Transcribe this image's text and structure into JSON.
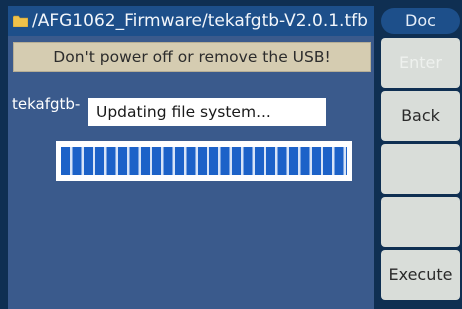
{
  "titlebar": {
    "path": "/AFG1062_Firmware/tekafgtb-V2.0.1.tfb",
    "folder_icon": "folder-icon",
    "folder_color": "#f0c24a"
  },
  "warning": {
    "text": "Don't power off or remove the USB!"
  },
  "file_line": {
    "text": "tekafgtb-"
  },
  "dialog": {
    "message": "Updating file system..."
  },
  "progress": {
    "value": 1.0
  },
  "sidebar": {
    "header": "Doc",
    "softkeys": [
      {
        "label": "Enter",
        "enabled": false
      },
      {
        "label": "Back",
        "enabled": true
      },
      {
        "label": "",
        "enabled": true
      },
      {
        "label": "",
        "enabled": true
      },
      {
        "label": "Execute",
        "enabled": true
      }
    ]
  }
}
